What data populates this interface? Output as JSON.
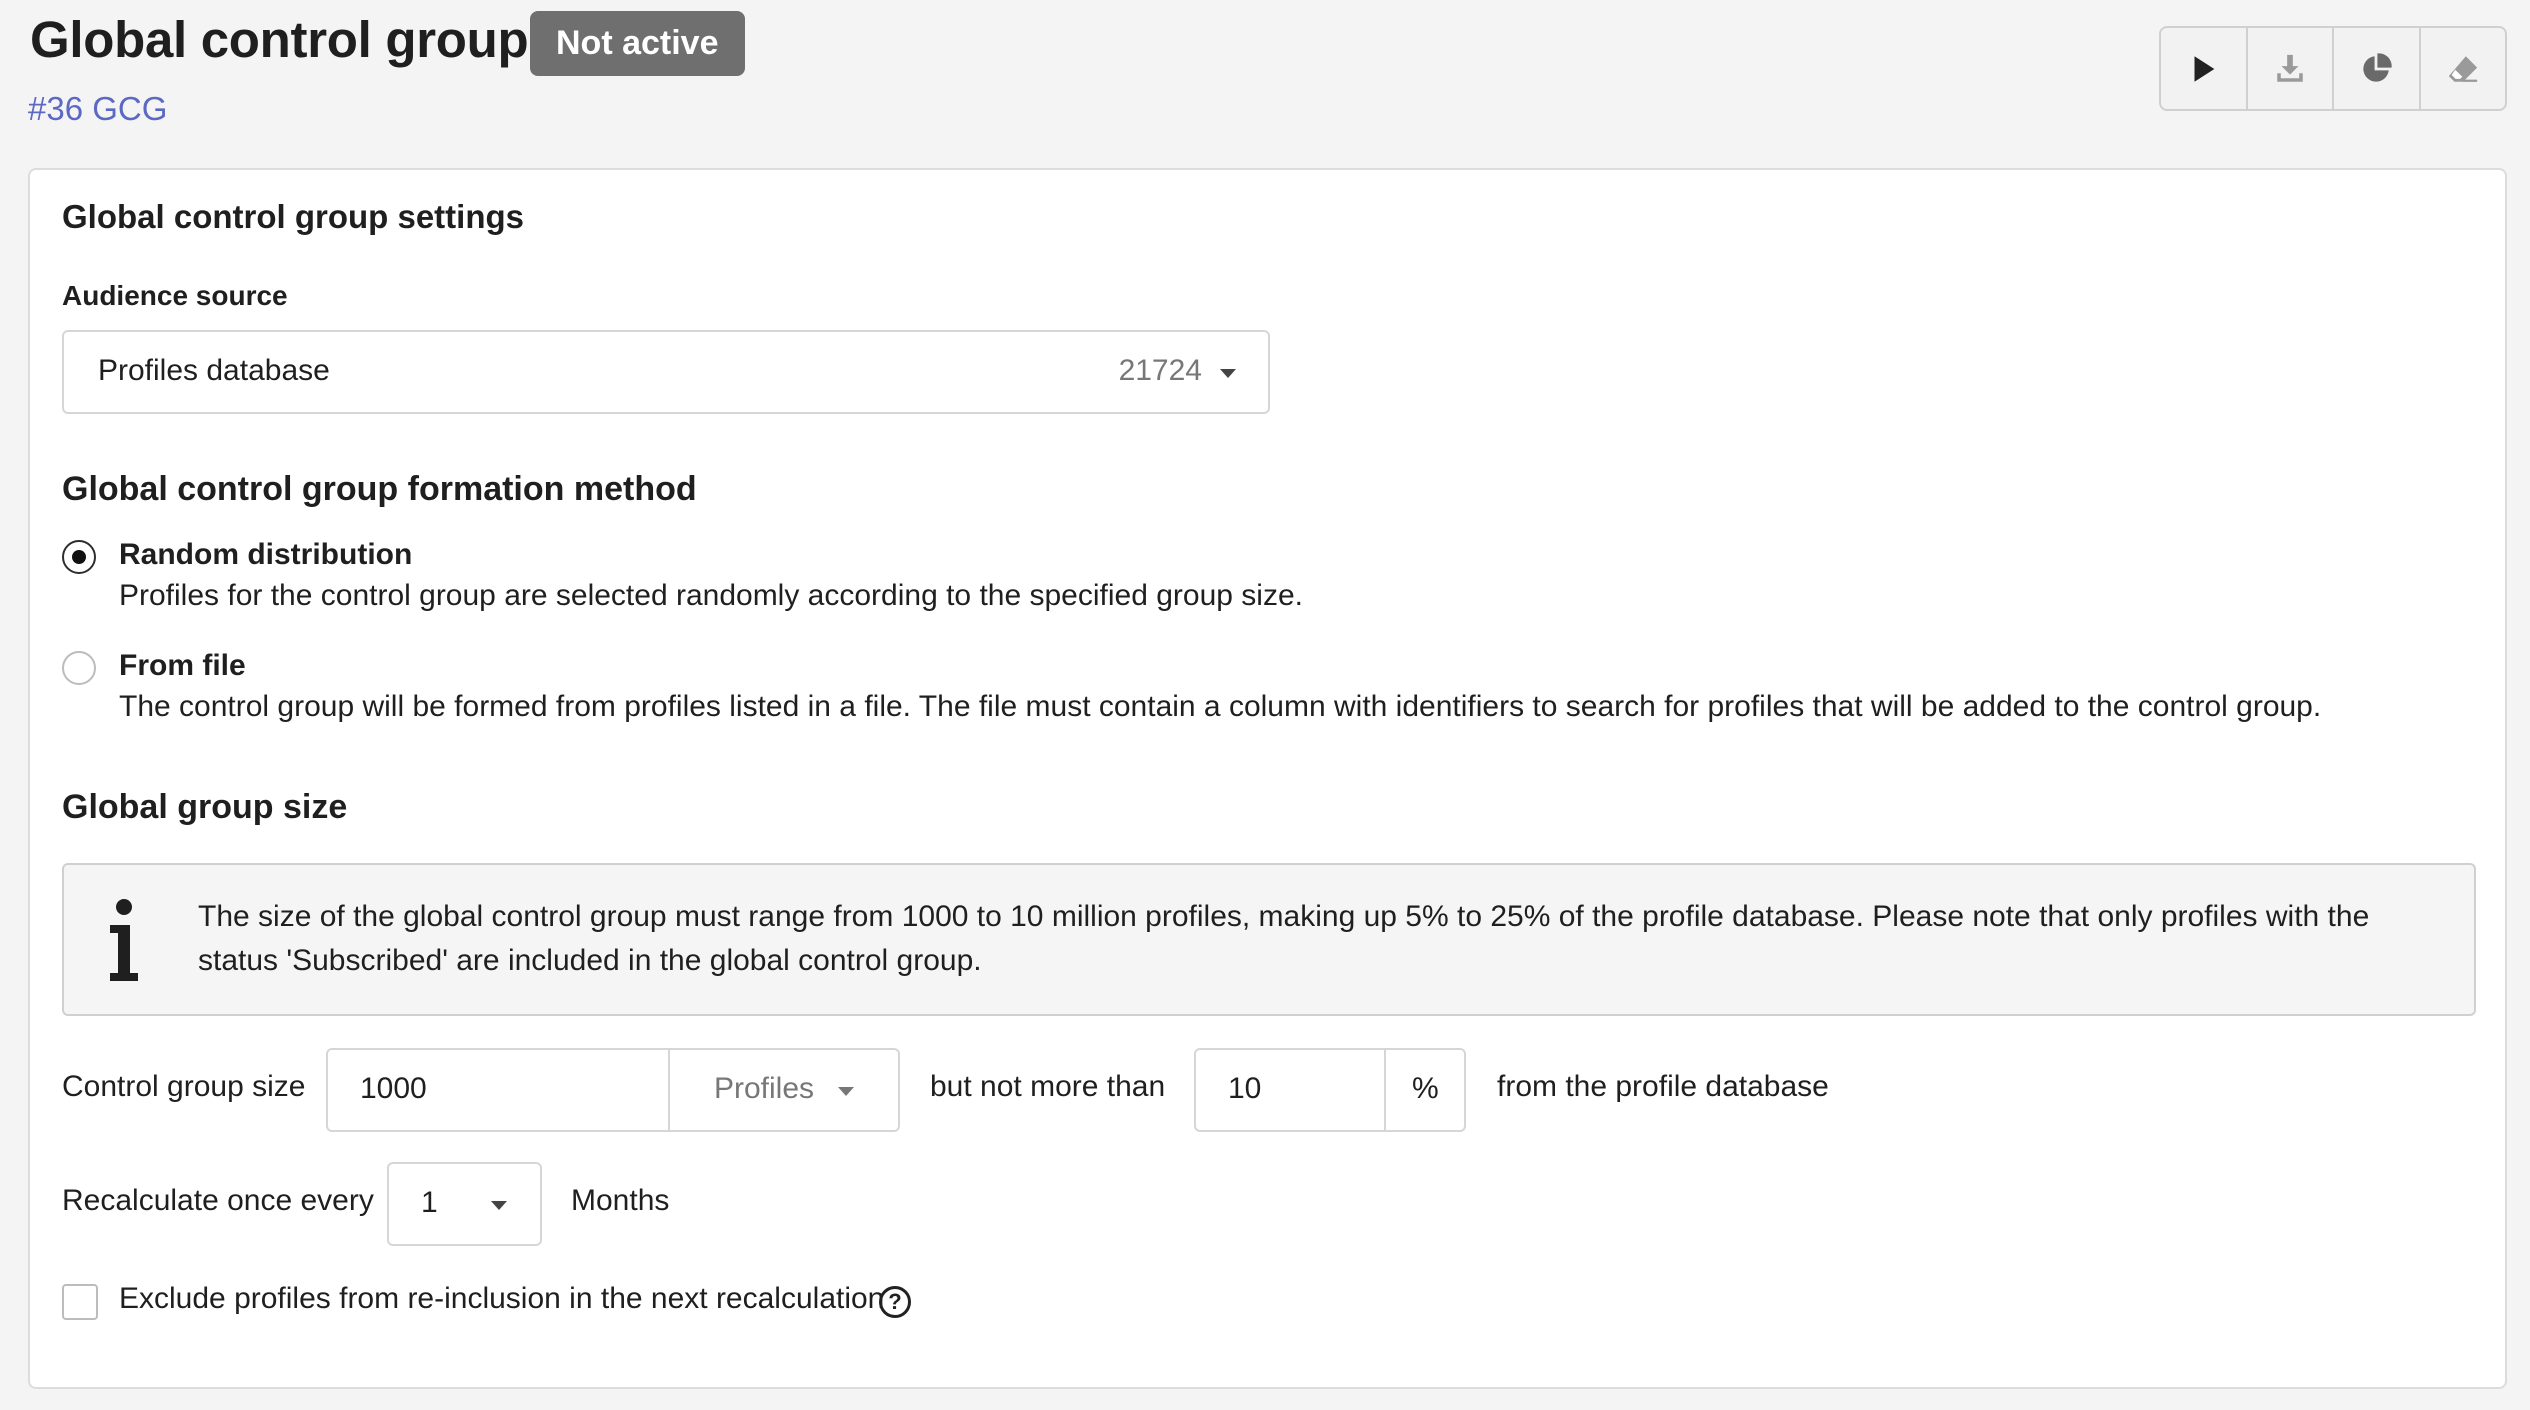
{
  "header": {
    "title": "Global control group",
    "status_badge": "Not active",
    "subtitle_link": "#36 GCG",
    "toolbar": [
      {
        "name": "play-icon"
      },
      {
        "name": "download-icon"
      },
      {
        "name": "pie-chart-icon"
      },
      {
        "name": "eraser-icon"
      }
    ]
  },
  "settings": {
    "title": "Global control group settings",
    "audience_source": {
      "label": "Audience source",
      "value": "Profiles database",
      "count": "21724"
    },
    "formation": {
      "title": "Global control group formation method",
      "options": [
        {
          "label": "Random distribution",
          "description": "Profiles for the control group are selected randomly according to the specified group size.",
          "checked": true
        },
        {
          "label": "From file",
          "description": "The control group will be formed from profiles listed in a file. The file must contain a column with identifiers to search for profiles that will be added to the control group.",
          "checked": false
        }
      ]
    },
    "size": {
      "title": "Global group size",
      "info": "The size of the global control group must range from 1000 to 10 million profiles, making up 5% to 25% of the profile database. Please note that only profiles with the status 'Subscribed' are included in the global control group.",
      "control_group_size_label": "Control group size",
      "control_group_size_value": "1000",
      "unit_select": "Profiles",
      "but_not_more_than": "but not more than",
      "max_value": "10",
      "percent_sign": "%",
      "from_profile_db": "from the profile database",
      "recalc_label": "Recalculate once every",
      "recalc_value": "1",
      "recalc_unit": "Months",
      "exclude_label": "Exclude profiles from re-inclusion in the next recalculation",
      "exclude_checked": false,
      "help_glyph": "?"
    }
  },
  "colors": {
    "badge": "#6f6f6f",
    "link": "#5b69c4",
    "background": "#f4f4f4",
    "card": "#ffffff"
  }
}
